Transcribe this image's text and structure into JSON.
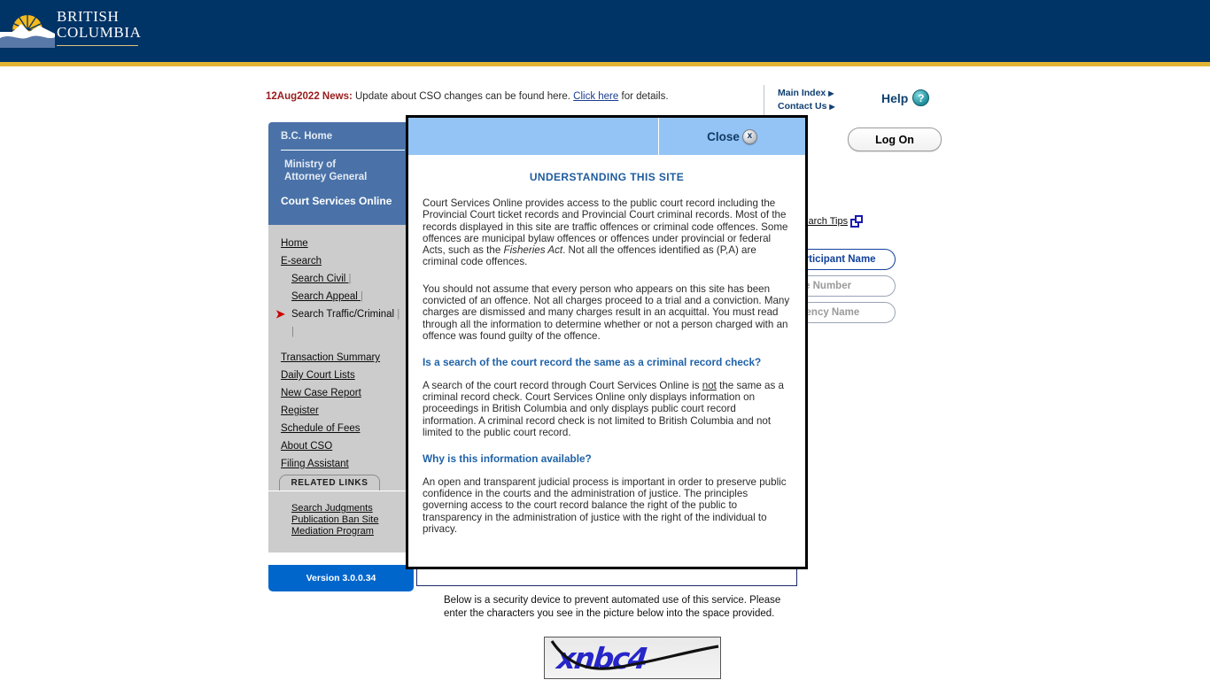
{
  "brand": {
    "line1": "BRITISH",
    "line2": "COLUMBIA",
    "logo_icon": "bc-sunburst-logo"
  },
  "news": {
    "date_label": "12Aug2022 News:",
    "message_before": "Update about CSO changes can be found here.",
    "link_text": "Click here",
    "message_after": "for details."
  },
  "top_nav": {
    "main_index": "Main Index",
    "contact_us": "Contact Us",
    "help_label": "Help",
    "help_icon": "question-mark-icon",
    "arrow_glyph": "▶"
  },
  "logon_button": "Log On",
  "sidebar": {
    "bc_home": "B.C. Home",
    "ministry_line1": "Ministry of",
    "ministry_line2": "Attorney General",
    "site_title": "Court Services Online",
    "links": [
      {
        "label": "Home",
        "indent": false,
        "selected": false,
        "trailing_pipe": false
      },
      {
        "label": "E-search",
        "indent": false,
        "selected": false,
        "trailing_pipe": false
      },
      {
        "label": "Search Civil",
        "indent": true,
        "selected": false,
        "trailing_pipe": true
      },
      {
        "label": "Search Appeal",
        "indent": true,
        "selected": false,
        "trailing_pipe": true
      },
      {
        "label": "Search Traffic/Criminal",
        "indent": true,
        "selected": true,
        "trailing_pipe": true
      },
      {
        "label": "",
        "indent": true,
        "selected": false,
        "trailing_pipe": true
      },
      {
        "label": "Transaction Summary",
        "indent": false,
        "selected": false,
        "trailing_pipe": false
      },
      {
        "label": "Daily Court Lists",
        "indent": false,
        "selected": false,
        "trailing_pipe": false
      },
      {
        "label": "New Case Report",
        "indent": false,
        "selected": false,
        "trailing_pipe": false
      },
      {
        "label": "Register",
        "indent": false,
        "selected": false,
        "trailing_pipe": false
      },
      {
        "label": "Schedule of Fees",
        "indent": false,
        "selected": false,
        "trailing_pipe": false
      },
      {
        "label": "About CSO",
        "indent": false,
        "selected": false,
        "trailing_pipe": false
      },
      {
        "label": "Filing Assistant",
        "indent": false,
        "selected": false,
        "trailing_pipe": false
      }
    ],
    "related_links_header": "RELATED LINKS",
    "related_links": [
      "Search Judgments",
      "Publication Ban Site",
      "Mediation Program"
    ],
    "version": "Version 3.0.0.34",
    "selected_arrow_icon": "right-arrow-icon"
  },
  "main": {
    "search_tips_label": "Search Tips",
    "search_tips_icon": "external-link-icon",
    "tabs": [
      {
        "label": "by Participant Name",
        "active": true
      },
      {
        "label": "by File Number",
        "active": false
      },
      {
        "label": "by Agency Name",
        "active": false
      }
    ],
    "captcha": {
      "instructions": "Below is a security device to prevent automated use of this service. Please enter the characters you see in the picture below into the space provided.",
      "image_text": "xnbc4",
      "image_alt": "captcha-image"
    }
  },
  "modal": {
    "close_label": "Close",
    "close_icon": "close-x-icon",
    "title": "UNDERSTANDING THIS SITE",
    "blocks": [
      {
        "kind": "paragraph",
        "html": "Court Services Online provides access to the public court record including the Provincial Court ticket records and Provincial Court criminal records. Most of the records displayed in this site are traffic offences or criminal code offences. Some offences are municipal bylaw offences or offences under provincial or federal Acts, such as the <em>Fisheries Act</em>. Not all the offences identified as (P,A) are criminal code offences."
      },
      {
        "kind": "paragraph",
        "html": "You should not assume that every person who appears on this site has been convicted of an offence. Not all charges proceed to a trial and a conviction. Many charges are dismissed and many charges result in an acquittal. You must read through all the information to determine whether or not a person charged with an offence was found guilty of the offence."
      },
      {
        "kind": "heading",
        "html": "Is a search of the court record the same as a criminal record check?"
      },
      {
        "kind": "paragraph",
        "html": "A search of the court record through Court Services Online is <u>not</u> the same as a criminal record check. Court Services Online only displays information on proceedings in British Columbia and only displays public court record information. A criminal record check is not limited to British Columbia and not limited to the public court record."
      },
      {
        "kind": "heading",
        "html": "Why is this information available?"
      },
      {
        "kind": "paragraph",
        "html": "An open and transparent judicial process is important in order to preserve public confidence in the courts and the administration of justice. The principles governing access to the court record balance the right of the public to transparency in the administration of justice with the right of the individual to privacy."
      }
    ]
  },
  "colors": {
    "header_navy": "#003366",
    "gold_strip": "#e3b434",
    "sidebar_blue": "#4a72a8",
    "sidebar_grey": "#cccccc",
    "version_blue": "#0066cc",
    "modal_header_blue": "#93c4f5",
    "heading_blue": "#1f62a8",
    "news_red": "#9b1b1b",
    "captcha_blue": "#2626c9"
  }
}
